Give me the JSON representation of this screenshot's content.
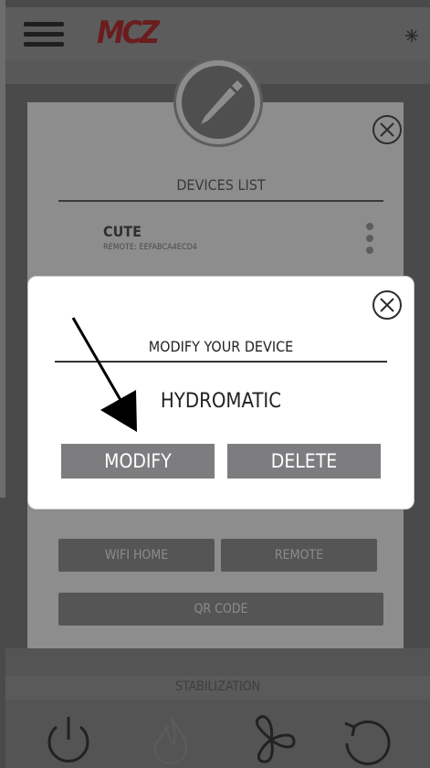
{
  "header": {
    "menu_icon": "hamburger-menu-icon",
    "logo_text": "MCZ",
    "right_icon": "snowflake-icon"
  },
  "devices_panel": {
    "title": "DEVICES LIST",
    "devices": [
      {
        "name": "CUTE",
        "subtitle": "REMOTE: EEFABCA4ECD4"
      }
    ],
    "buttons": {
      "wifi_home": "WIFI HOME",
      "remote": "REMOTE",
      "qr_code": "QR CODE"
    }
  },
  "modal": {
    "title": "MODIFY YOUR DEVICE",
    "device_name": "HYDROMATIC",
    "modify_label": "MODIFY",
    "delete_label": "DELETE"
  },
  "status": {
    "label": "STABILIZATION"
  },
  "bottom_nav": [
    "power-icon",
    "flame-icon",
    "fan-icon",
    "refresh-icon"
  ]
}
